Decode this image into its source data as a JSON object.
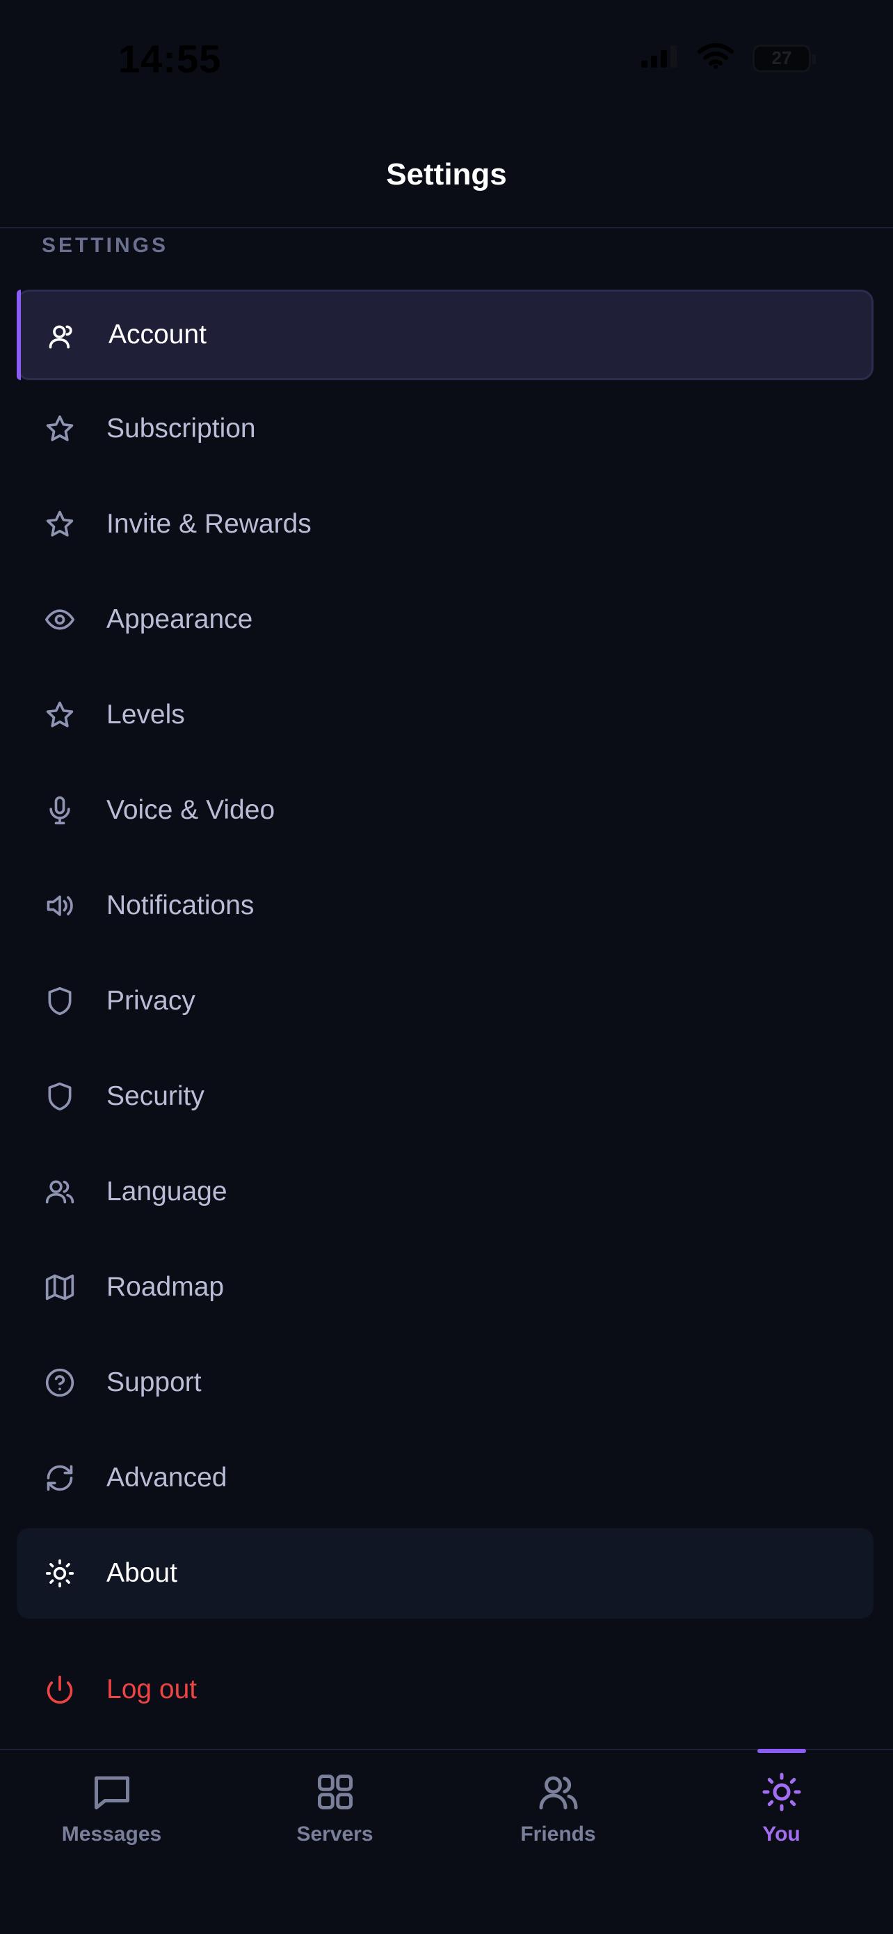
{
  "status_bar": {
    "time": "14:55",
    "battery": "27",
    "icons": [
      "signal-icon",
      "wifi-icon",
      "battery-icon"
    ]
  },
  "header": {
    "title": "Settings"
  },
  "section": {
    "label": "SETTINGS"
  },
  "menu": {
    "items": [
      {
        "label": "Account",
        "icon": "user-icon"
      },
      {
        "label": "Subscription",
        "icon": "star-icon"
      },
      {
        "label": "Invite & Rewards",
        "icon": "star-icon"
      },
      {
        "label": "Appearance",
        "icon": "eye-icon"
      },
      {
        "label": "Levels",
        "icon": "star-icon"
      },
      {
        "label": "Voice & Video",
        "icon": "microphone-icon"
      },
      {
        "label": "Notifications",
        "icon": "speaker-icon"
      },
      {
        "label": "Privacy",
        "icon": "shield-icon"
      },
      {
        "label": "Security",
        "icon": "shield-icon"
      },
      {
        "label": "Language",
        "icon": "users-icon"
      },
      {
        "label": "Roadmap",
        "icon": "map-icon"
      },
      {
        "label": "Support",
        "icon": "help-circle-icon"
      },
      {
        "label": "Advanced",
        "icon": "refresh-icon"
      },
      {
        "label": "About",
        "icon": "sun-icon"
      },
      {
        "label": "Log out",
        "icon": "power-icon"
      }
    ]
  },
  "tab_bar": {
    "tabs": [
      {
        "label": "Messages",
        "icon": "message-icon"
      },
      {
        "label": "Servers",
        "icon": "grid-icon"
      },
      {
        "label": "Friends",
        "icon": "friends-icon"
      },
      {
        "label": "You",
        "icon": "sun-icon"
      }
    ],
    "active": "You"
  },
  "colors": {
    "background": "#0a0c16",
    "accent": "#8b5cf6",
    "logout": "#ef4444",
    "text_muted": "#b9bdd6"
  }
}
